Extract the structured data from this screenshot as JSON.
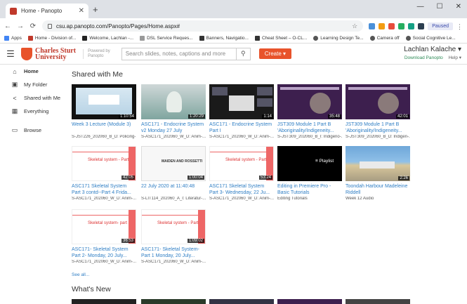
{
  "browser": {
    "tab_title": "Home - Panopto",
    "new_tab": "+",
    "url": "csu.ap.panopto.com/Panopto/Pages/Home.aspx#",
    "paused_label": "Paused",
    "window_controls": [
      "—",
      "☐",
      "✕"
    ]
  },
  "bookmarks": [
    "Apps",
    "Home - Division of...",
    "Welcome, Lachlan -...",
    "DSL Service Reques...",
    "Banners, Navigatio...",
    "Cheat Sheet – O-CL...",
    "Learning Design Te...",
    "Camera off",
    "Social Cognitive Le..."
  ],
  "header": {
    "logo_line1": "Charles Sturt",
    "logo_line2": "University",
    "powered_by_line1": "Powered by",
    "powered_by_line2": "Panopto",
    "search_placeholder": "Search slides, notes, captions and more",
    "create_label": "Create ▾",
    "user_name": "Lachlan Kalache ▾",
    "download_label": "Download Panopto",
    "help_label": "Help ▾"
  },
  "sidebar": {
    "items": [
      {
        "label": "Home",
        "icon": "home-icon"
      },
      {
        "label": "My Folder",
        "icon": "folder-video-icon"
      },
      {
        "label": "Shared with Me",
        "icon": "share-icon"
      },
      {
        "label": "Everything",
        "icon": "grid-icon"
      },
      {
        "label": "Browse",
        "icon": "folder-icon"
      }
    ]
  },
  "main": {
    "shared_title": "Shared with Me",
    "whats_new_title": "What's New",
    "see_all": "See all...",
    "cards": [
      {
        "title": "Week 3 Lecture (Module 3)",
        "folder": "S-JST226_202060_B_D: Policing-...",
        "duration": "1:10:54"
      },
      {
        "title": "ASC171 - Endocrine System v2 Monday 27 July",
        "folder": "S-ASC171_202060_W_D: Anim-...",
        "duration": "1:20:29"
      },
      {
        "title": "ASC171 - Endocrine System Part I",
        "folder": "S-ASC171_202060_W_D: Anim-...",
        "duration": "1:14"
      },
      {
        "title": "JST309 Module 1 Part B 'Aboriginality/Indigeneity...",
        "folder": "S-JST309_202060_B_I: Indigeno-...",
        "duration": "35:48"
      },
      {
        "title": "JST309 Module 1 Part B 'Aboriginality/Indigeneity...",
        "folder": "S-JST309_202060_B_D: Indigen-...",
        "duration": "42:01"
      },
      {
        "title": "ASC171 Skeletal System Part 3 contd--Part 4 Frida...",
        "folder": "S-ASC171_202060_W_D: Anim-...",
        "duration": "42:05"
      },
      {
        "title": "22 July 2020 at 11:40:48",
        "folder": "S-LIT114_202060_A_I: Literatur-...",
        "duration": "1:00:04"
      },
      {
        "title": "ASC171 Skeletal System Part 3- Wednesday, 22 Ju...",
        "folder": "S-ASC171_202060_W_D: Anim-...",
        "duration": "53:24"
      },
      {
        "title": "Editing in Premiere Pro - Basic Tutorials",
        "folder": "Editing Tutorials",
        "duration": ""
      },
      {
        "title": "Toondah Harbour Madeleine Riddell",
        "folder": "Week 12 Audio",
        "duration": "2:26"
      },
      {
        "title": "ASC171- Skeletal System Part 2- Monday, 20 July...",
        "folder": "S-ASC171_202060_W_D: Anim-...",
        "duration": "36:53"
      },
      {
        "title": "ASC171- Skeletal System-Part 1 Monday, 20 July...",
        "folder": "S-ASC171_202060_W_D: Anim-...",
        "duration": "1:09:02"
      }
    ],
    "thumb_text": {
      "skeletal_a": "Skeletal system - Part 3",
      "paper": "MAIDEN AND ROSSETTI",
      "skeletal_b": "Skeletal system - Part 3",
      "playlist": "Playlist",
      "skeletal_c": "Skeletal system- part 2",
      "skeletal_d": "Skeletal system - Part 1"
    }
  },
  "colors": {
    "brand": "#c0392b",
    "create": "#e8532b",
    "link": "#2f7ec4"
  }
}
